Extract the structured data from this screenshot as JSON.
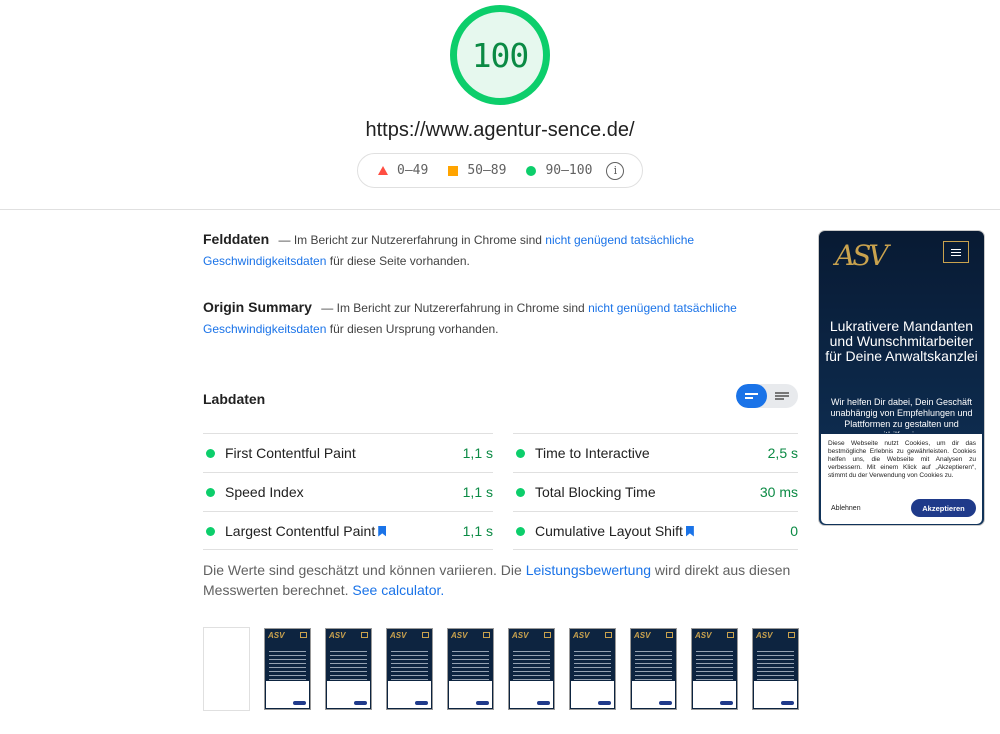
{
  "score": "100",
  "url": "https://www.agentur-sence.de/",
  "legend": {
    "fail": "0–49",
    "average": "50–89",
    "pass": "90–100",
    "info_icon": "info-icon",
    "colors": {
      "fail": "#ff4e42",
      "average": "#ffa400",
      "pass": "#0cce6b"
    }
  },
  "field": {
    "title": "Felddaten",
    "dash": "—",
    "text_before": "Im Bericht zur Nutzererfahrung in Chrome sind",
    "link": "nicht genügend tatsächliche Geschwindigkeitsdaten",
    "text_after": "für diese Seite vorhanden."
  },
  "origin": {
    "title": "Origin Summary",
    "dash": "—",
    "text_before": "Im Bericht zur Nutzererfahrung in Chrome sind",
    "link": "nicht genügend tatsächliche Geschwindigkeitsdaten",
    "text_after": "für diesen Ursprung vorhanden."
  },
  "lab": {
    "title": "Labdaten",
    "metrics": [
      {
        "label": "First Contentful Paint",
        "value": "1,1 s"
      },
      {
        "label": "Time to Interactive",
        "value": "2,5 s"
      },
      {
        "label": "Speed Index",
        "value": "1,1 s"
      },
      {
        "label": "Total Blocking Time",
        "value": "30 ms"
      },
      {
        "label": "Largest Contentful Paint",
        "value": "1,1 s"
      },
      {
        "label": "Cumulative Layout Shift",
        "value": "0"
      }
    ],
    "note_before": "Die Werte sind geschätzt und können variieren. Die",
    "note_link1": "Leistungsbewertung",
    "note_middle": "wird direkt aus diesen Messwerten berechnet.",
    "note_link2": "See calculator."
  },
  "preview": {
    "logo": "ASV",
    "headline": "Lukrativere Mandanten und Wunschmitarbeiter für Deine Anwaltskanzlei",
    "subtext": "Wir helfen Dir dabei, Dein Geschäft unabhängig von Empfehlungen und Plattformen zu gestalten und mithilfe einer",
    "cookie_text": "Diese Webseite nutzt Cookies, um dir das bestmögliche Erlebnis zu gewährleisten. Cookies helfen uns, die Webseite mit Analysen zu verbessern. Mit einem Klick auf „Akzeptieren“, stimmt du der Verwendung von Cookies zu.",
    "reject": "Ablehnen",
    "accept": "Akzeptieren"
  },
  "filmstrip": {
    "thumb_logo": "ASV"
  }
}
